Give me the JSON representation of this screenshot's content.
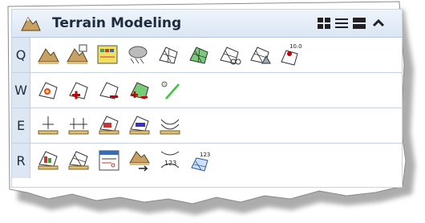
{
  "panel": {
    "title": "Terrain Modeling",
    "title_icon": "terrain-modeling-icon",
    "view_buttons": [
      {
        "icon": "icon-grid-view-icon"
      },
      {
        "icon": "list-view-icon"
      },
      {
        "icon": "large-list-view-icon"
      },
      {
        "icon": "collapse-chevron-up-icon"
      }
    ]
  },
  "rows": [
    {
      "key": "Q",
      "tools": [
        "create-terrain-from-elements-icon",
        "create-terrain-from-file-icon",
        "create-terrain-from-graphic-filter-icon",
        "create-terrain-from-point-cloud-icon",
        "create-terrain-model-icon",
        "create-clipping-terrain-icon",
        "create-from-clipped-terrain-icon",
        "create-delta-terrain-icon",
        "terrain-with-elevation-label-icon"
      ]
    },
    {
      "key": "W",
      "tools": [
        "add-point-to-terrain-icon",
        "add-feature-to-terrain-icon",
        "remove-feature-from-terrain-icon",
        "add-remove-features-icon",
        "draw-line-icon"
      ]
    },
    {
      "key": "E",
      "tools": [
        "insert-vertex-icon",
        "delete-vertex-icon",
        "edit-terrain-icon",
        "edit-terrain-boundary-icon",
        "swap-lines-icon"
      ]
    },
    {
      "key": "R",
      "tools": [
        "terrain-analysis-icon",
        "terrain-profile-icon",
        "terrain-report-icon",
        "export-terrain-icon",
        "contour-label-icon",
        "spot-elevation-label-icon"
      ]
    }
  ],
  "labels": {
    "elevation_value": "10.0",
    "contour_value": "123",
    "spot_value": "123"
  }
}
